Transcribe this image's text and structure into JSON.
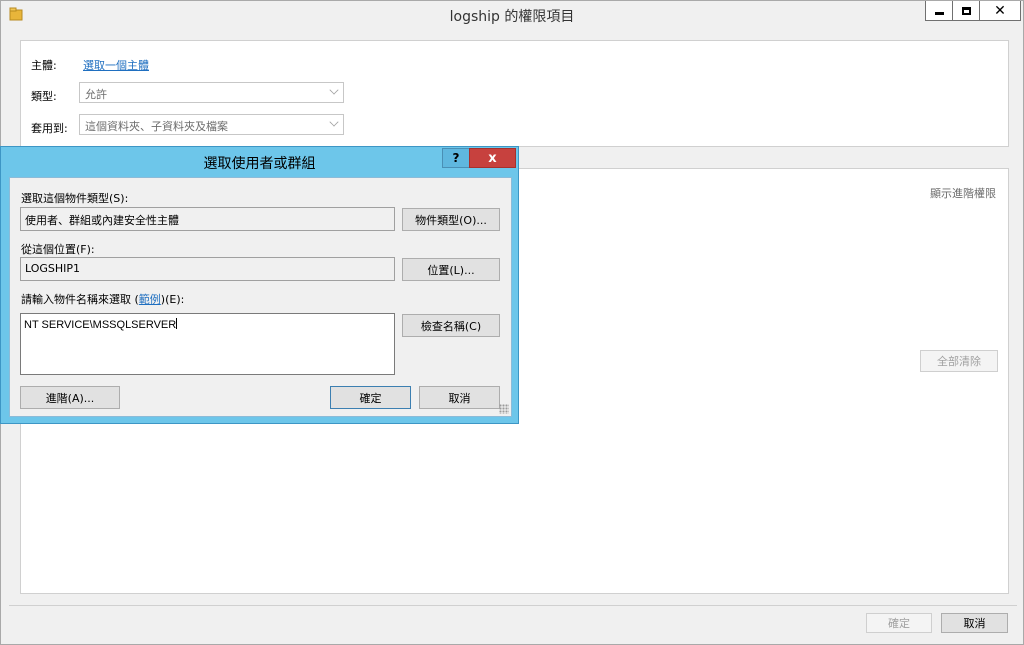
{
  "window": {
    "title": "logship 的權限項目",
    "close_glyph": "✕"
  },
  "entry": {
    "principal_label": "主體:",
    "principal_link": "選取一個主體",
    "type_label": "類型:",
    "type_value": "允許",
    "applies_label": "套用到:",
    "applies_value": "這個資料夾、子資料夾及檔案"
  },
  "permissions": {
    "advanced_link": "顯示進階權限",
    "clear_all": "全部清除"
  },
  "footer": {
    "ok": "確定",
    "cancel": "取消"
  },
  "dialog": {
    "title": "選取使用者或群組",
    "help_glyph": "?",
    "close_glyph": "x",
    "object_type_label": "選取這個物件類型(S):",
    "object_type_value": "使用者、群組或內建安全性主體",
    "object_type_button": "物件類型(O)...",
    "location_label": "從這個位置(F):",
    "location_value": "LOGSHIP1",
    "location_button": "位置(L)...",
    "names_label_prefix": "請輸入物件名稱來選取 (",
    "names_label_link": "範例",
    "names_label_suffix": ")(E):",
    "names_value": "NT SERVICE\\MSSQLSERVER",
    "check_names_button": "檢查名稱(C)",
    "advanced_button": "進階(A)...",
    "ok_button": "確定",
    "cancel_button": "取消"
  },
  "colors": {
    "dialog_frame": "#6dc6ea",
    "link": "#1f6fc0",
    "close_red": "#c7413e"
  }
}
